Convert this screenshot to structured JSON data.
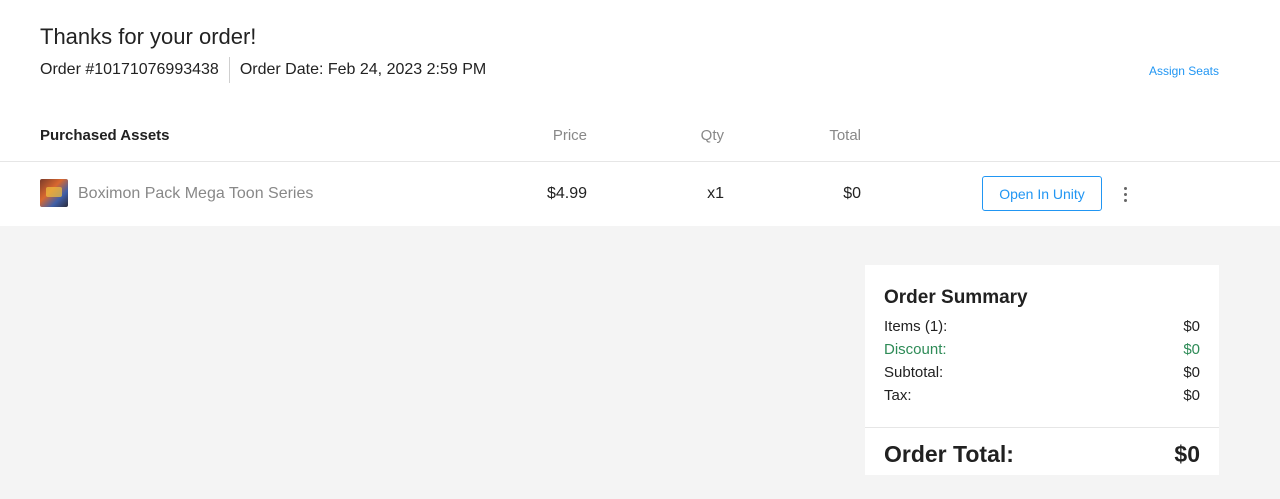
{
  "header": {
    "title": "Thanks for your order!",
    "order_number": "Order #10171076993438",
    "order_date": "Order Date: Feb 24, 2023 2:59 PM",
    "assign_seats": "Assign Seats"
  },
  "table": {
    "columns": {
      "assets": "Purchased Assets",
      "price": "Price",
      "qty": "Qty",
      "total": "Total"
    },
    "rows": [
      {
        "name": "Boximon Pack Mega Toon Series",
        "price": "$4.99",
        "qty": "x1",
        "total": "$0",
        "action_label": "Open In Unity"
      }
    ]
  },
  "summary": {
    "title": "Order Summary",
    "items_label": "Items (1):",
    "items_value": "$0",
    "discount_label": "Discount:",
    "discount_value": "$0",
    "subtotal_label": "Subtotal:",
    "subtotal_value": "$0",
    "tax_label": "Tax:",
    "tax_value": "$0",
    "total_label": "Order Total:",
    "total_value": "$0"
  },
  "colors": {
    "accent": "#2196f3",
    "discount": "#2e8b57",
    "background": "#f4f4f4"
  },
  "icons": {
    "row_menu": "kebab-menu-icon",
    "asset_thumbnail": "asset-thumbnail"
  }
}
